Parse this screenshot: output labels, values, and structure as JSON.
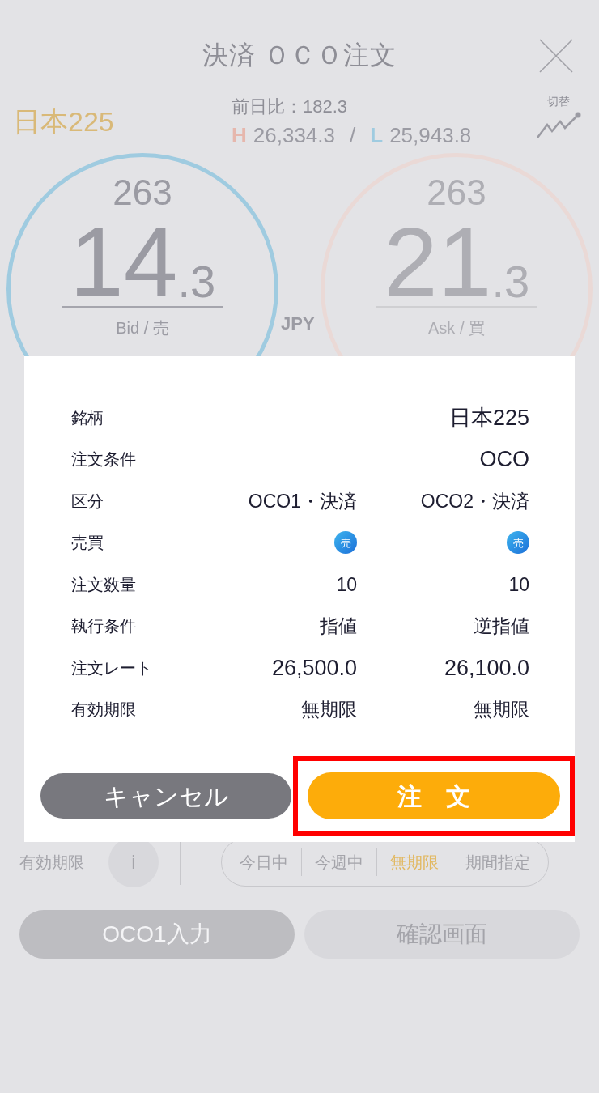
{
  "header": {
    "title": "決済 ＯＣＯ注文"
  },
  "summary": {
    "symbol": "日本225",
    "change": "前日比：182.3",
    "high_label": "H",
    "high": "26,334.3",
    "separator": "/",
    "low_label": "L",
    "low": "25,943.8",
    "switch_label": "切替"
  },
  "quotes": [
    {
      "kind": "bid",
      "prefix": "263",
      "main": "14",
      "decimal": ".3",
      "label": "Bid / 売"
    },
    {
      "kind": "ask",
      "prefix": "263",
      "main": "21",
      "decimal": ".3",
      "label": "Ask / 買"
    }
  ],
  "currency": "JPY",
  "expiry": {
    "label": "有効期限",
    "info": "i",
    "options": [
      {
        "label": "今日中",
        "selected": false
      },
      {
        "label": "今週中",
        "selected": false
      },
      {
        "label": "無期限",
        "selected": true
      },
      {
        "label": "期間指定",
        "selected": false
      }
    ]
  },
  "footer_buttons": [
    {
      "label": "OCO1入力",
      "kind": "dark"
    },
    {
      "label": "確認画面",
      "kind": "light"
    }
  ],
  "dialog": {
    "rows": [
      {
        "kind": "single",
        "label": "銘柄",
        "value": "日本225"
      },
      {
        "kind": "single",
        "label": "注文条件",
        "value": "OCO"
      },
      {
        "kind": "pair",
        "label": "区分",
        "values": [
          "OCO1・決済",
          "OCO2・決済"
        ]
      },
      {
        "kind": "badge",
        "label": "売買",
        "values": [
          "売",
          "売"
        ]
      },
      {
        "kind": "pair",
        "label": "注文数量",
        "values": [
          "10",
          "10"
        ]
      },
      {
        "kind": "pair",
        "label": "執行条件",
        "values": [
          "指値",
          "逆指値"
        ]
      },
      {
        "kind": "pair",
        "label": "注文レート",
        "values": [
          "26,500.0",
          "26,100.0"
        ],
        "emphasis": true
      },
      {
        "kind": "pair",
        "label": "有効期限",
        "values": [
          "無期限",
          "無期限"
        ]
      }
    ],
    "cancel": "キャンセル",
    "confirm": "注　文",
    "confirm_highlighted": true
  }
}
